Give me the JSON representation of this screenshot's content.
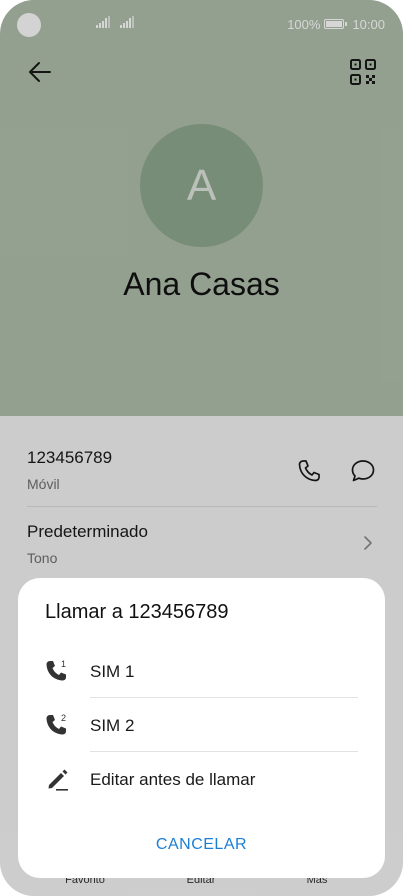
{
  "status_bar": {
    "battery": "100%",
    "time": "10:00"
  },
  "contact": {
    "initial": "A",
    "name": "Ana Casas"
  },
  "details": {
    "number": "123456789",
    "number_type": "Móvil",
    "ringtone": "Predeterminado",
    "ringtone_label": "Tono"
  },
  "bottom_nav": {
    "items": [
      "Favorito",
      "Editar",
      "Más"
    ]
  },
  "dialog": {
    "title": "Llamar a 123456789",
    "options": [
      {
        "label": "SIM 1",
        "icon": "phone-sim1-icon"
      },
      {
        "label": "SIM 2",
        "icon": "phone-sim2-icon"
      },
      {
        "label": "Editar antes de llamar",
        "icon": "pencil-icon"
      }
    ],
    "cancel": "CANCELAR"
  },
  "colors": {
    "header_bg": "#b0bfab",
    "avatar_bg": "#8fa98e",
    "accent": "#1b7fd6"
  }
}
